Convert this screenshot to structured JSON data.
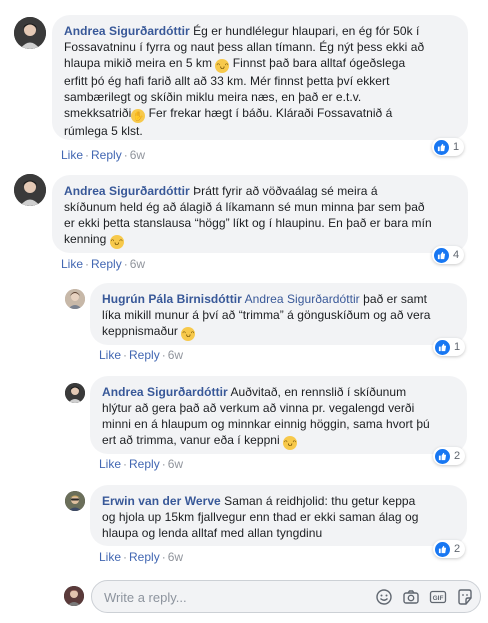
{
  "comments": [
    {
      "author": "Andrea Sigurðardóttir",
      "lines": [
        " Ég er hundlélegur hlaupari, en ég fór 50k í",
        "Fossavatninu í fyrra og naut þess allan tímann. Ég nýt þess ekki að",
        "hlaupa mikið meira en 5 km",
        " Finnst það bara alltaf ógeðslega",
        "erfitt þó ég hafi farið allt að 33 km. Mér finnst þetta því ekkert",
        "sambærilegt og skíðin miklu meira næs, en það er e.t.v.",
        "smekksatriði",
        " Fer frekar hægt í báðu. Kláraði Fossavatnið á",
        "rúmlega 5 klst."
      ],
      "like": "Like",
      "reply": "Reply",
      "time": "6w",
      "reactions": "1"
    },
    {
      "author": "Andrea Sigurðardóttir",
      "lines": [
        " Þrátt fyrir að vöðvaálag sé meira á",
        "skíðunum held ég að álagið á líkamann sé mun minna þar sem það",
        "er ekki þetta stanslausa “högg” líkt og í hlaupinu. En það er bara mín",
        "kenning"
      ],
      "like": "Like",
      "reply": "Reply",
      "time": "6w",
      "reactions": "4"
    },
    {
      "author": "Hugrún Pála Birnisdóttir",
      "mention": "Andrea Sigurðardóttir",
      "lines": [
        " það er samt",
        "líka mikill munur á því að “trimma” á gönguskíðum og að vera",
        "keppnismaður"
      ],
      "like": "Like",
      "reply": "Reply",
      "time": "6w",
      "reactions": "1"
    },
    {
      "author": "Andrea Sigurðardóttir",
      "lines": [
        " Auðvitað, en rennslið í skíðunum",
        "hlýtur að gera það að verkum að vinna pr. vegalengd verði",
        "minni en á hlaupum og minnkar einnig höggin, sama hvort þú",
        "ert að trimma, vanur eða í keppni"
      ],
      "like": "Like",
      "reply": "Reply",
      "time": "6w",
      "reactions": "2"
    },
    {
      "author": "Erwin van der Werve",
      "lines": [
        " Saman á reidhjolid: thu getur keppa",
        "og hjola up 15km fjallvegur enn thad er ekki saman álag og",
        "hlaupa og lenda alltaf med allan tyngdinu"
      ],
      "like": "Like",
      "reply": "Reply",
      "time": "6w",
      "reactions": "2"
    }
  ],
  "composer": {
    "placeholder": "Write a reply..."
  },
  "icons": [
    "smiley-icon",
    "camera-icon",
    "gif-icon",
    "sticker-icon",
    "like-icon"
  ],
  "colors": {
    "link": "#385898",
    "bubble": "#f2f3f5",
    "like_blue": "#1877f2"
  }
}
